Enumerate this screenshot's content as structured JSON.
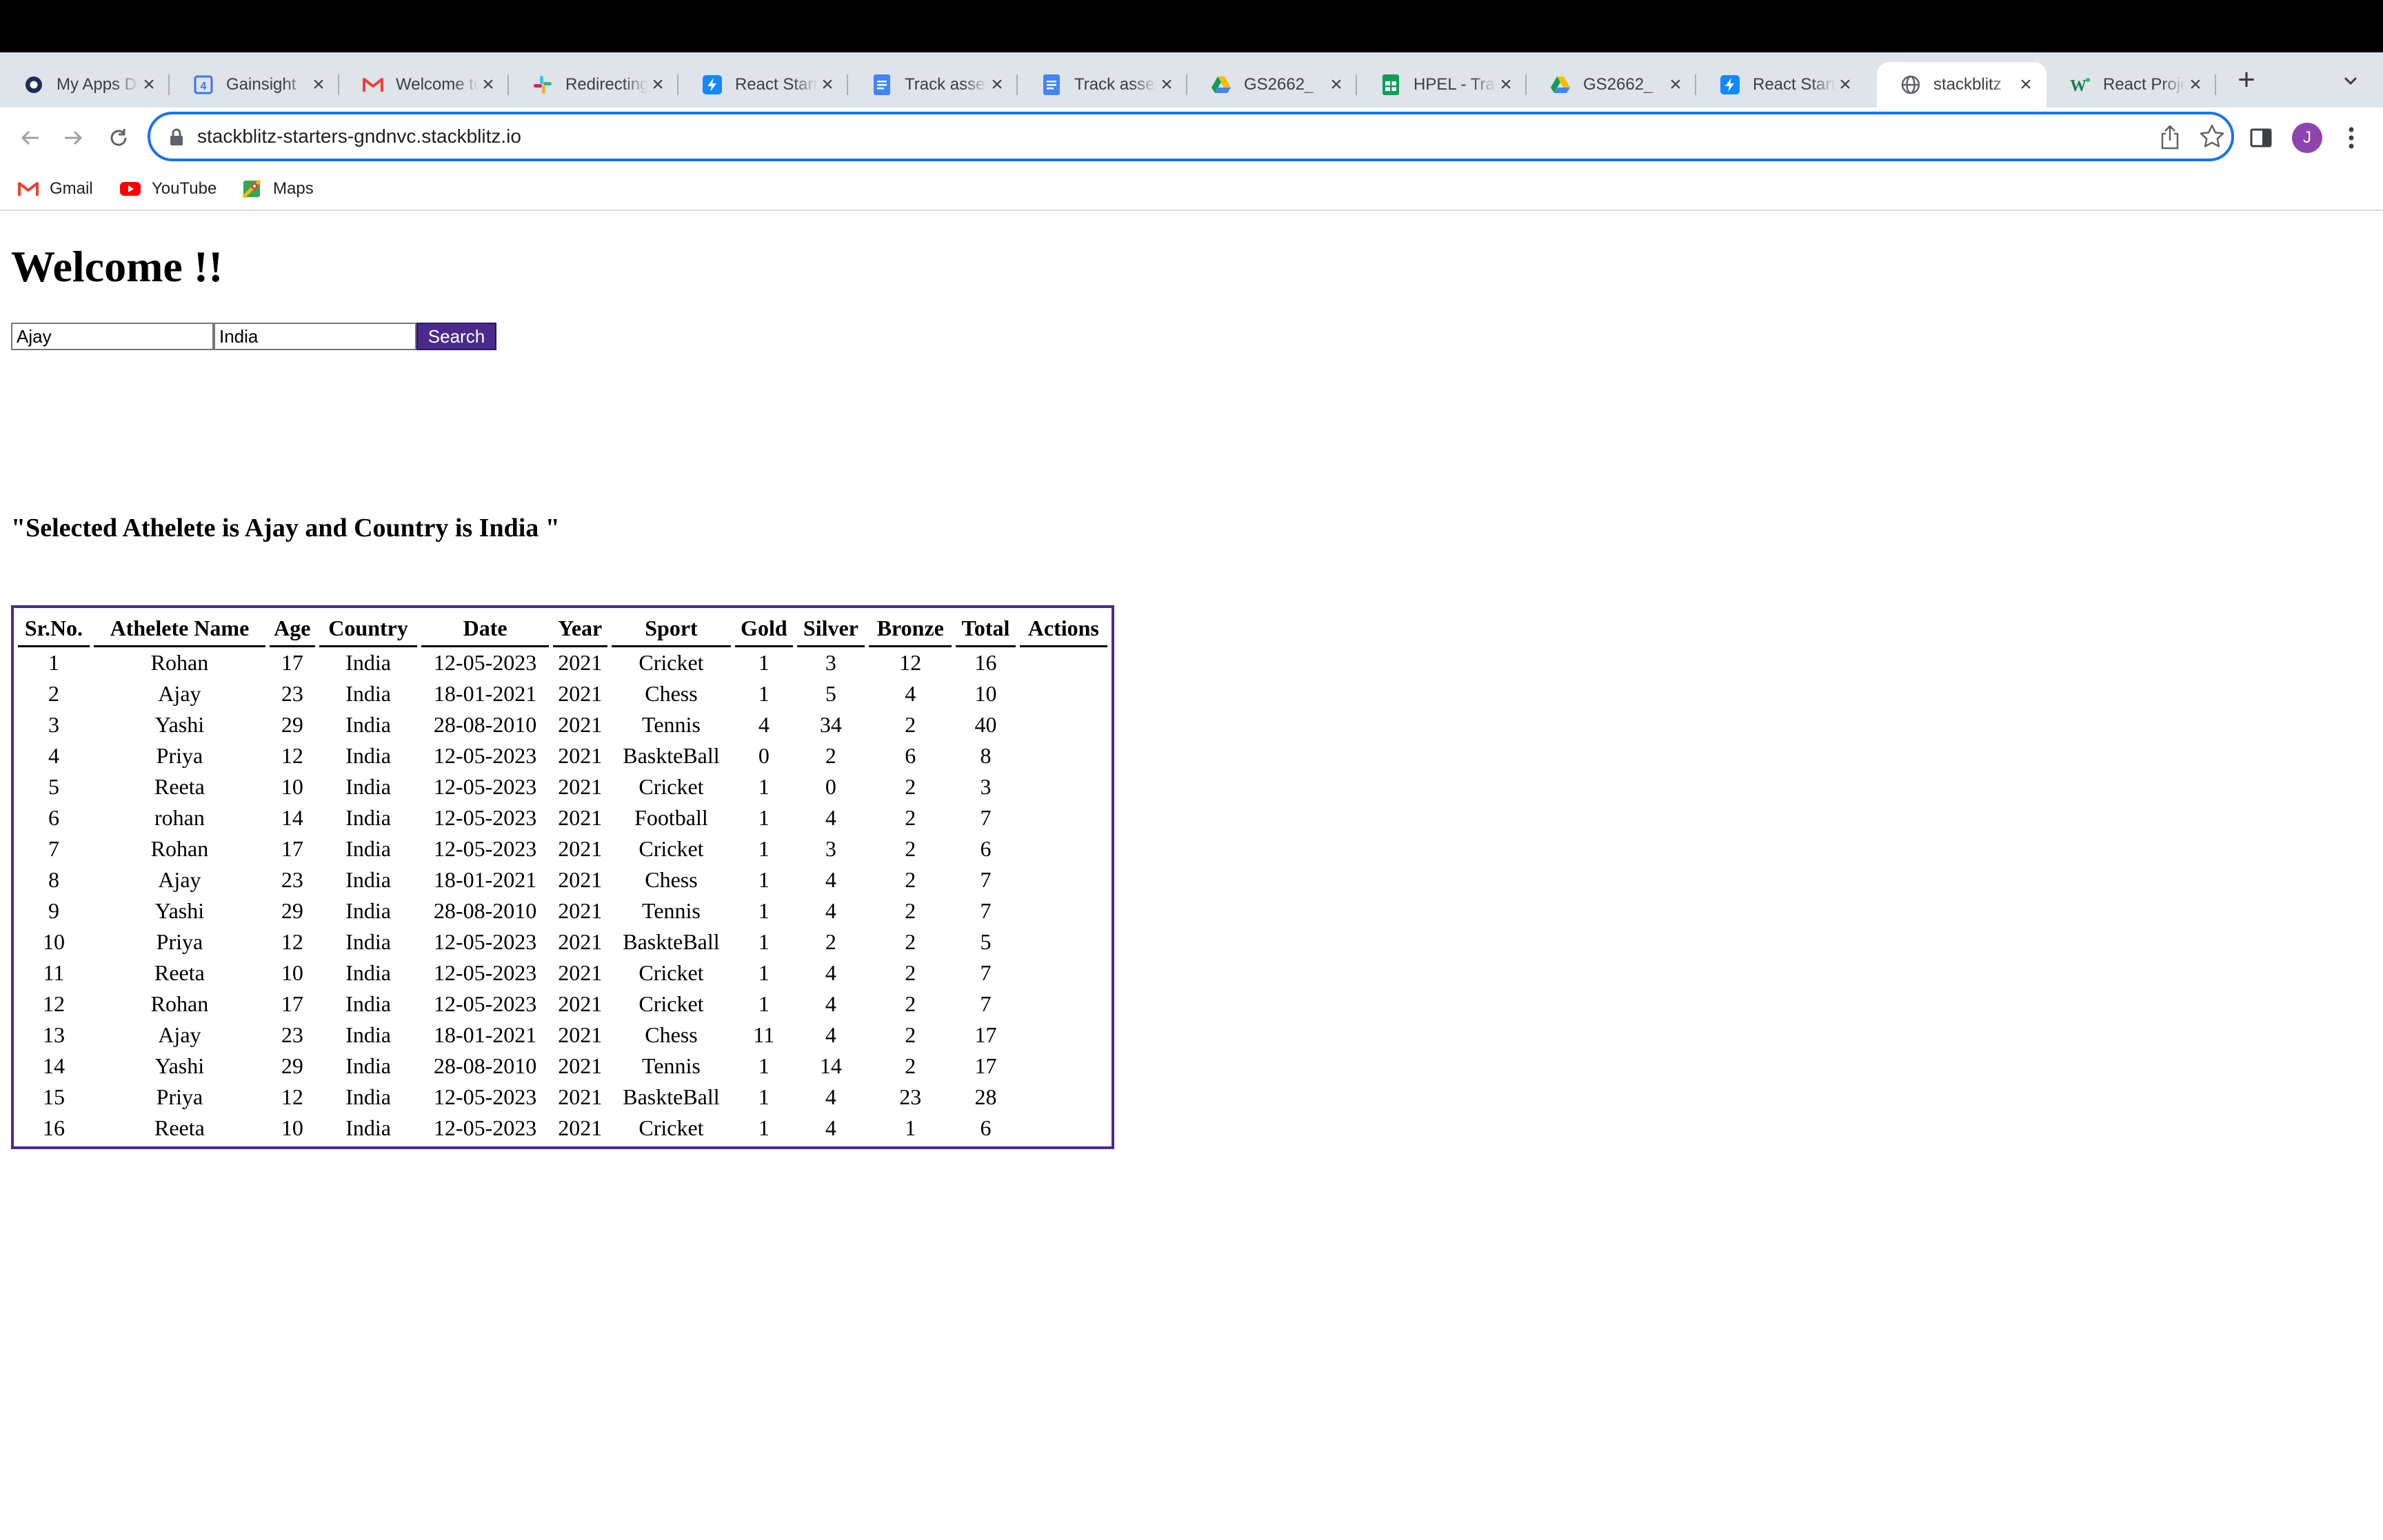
{
  "browser": {
    "tabs": [
      {
        "title": "My Apps Dashboard",
        "icon": "okta-icon"
      },
      {
        "title": "Gainsight",
        "icon": "gainsight-icon"
      },
      {
        "title": "Welcome to Gmail",
        "icon": "gmail-icon"
      },
      {
        "title": "Redirecting",
        "icon": "slack-icon"
      },
      {
        "title": "React Starter",
        "icon": "stackblitz-icon"
      },
      {
        "title": "Track assets",
        "icon": "docs-icon"
      },
      {
        "title": "Track assets",
        "icon": "docs-icon"
      },
      {
        "title": "GS2662_",
        "icon": "drive-icon"
      },
      {
        "title": "HPEL - Tracker",
        "icon": "sheets-icon"
      },
      {
        "title": "GS2662_",
        "icon": "drive-icon"
      },
      {
        "title": "React Starter",
        "icon": "stackblitz-icon"
      },
      {
        "title": "stackblitz",
        "icon": "globe-icon",
        "active": true
      },
      {
        "title": "React Project",
        "icon": "w-icon"
      }
    ],
    "url": "stackblitz-starters-gndnvc.stackblitz.io",
    "profile_initial": "J",
    "bookmarks": [
      {
        "label": "Gmail",
        "icon": "gmail-icon"
      },
      {
        "label": "YouTube",
        "icon": "youtube-icon"
      },
      {
        "label": "Maps",
        "icon": "maps-icon"
      }
    ]
  },
  "page": {
    "heading": "Welcome !!",
    "athlete_input_value": "Ajay",
    "country_input_value": "India",
    "search_label": "Search",
    "selected_text": "\"Selected Athelete is Ajay and Country is India \"",
    "table": {
      "headers": [
        "Sr.No.",
        "Athelete Name",
        "Age",
        "Country",
        "Date",
        "Year",
        "Sport",
        "Gold",
        "Silver",
        "Bronze",
        "Total",
        "Actions"
      ],
      "rows": [
        [
          "1",
          "Rohan",
          "17",
          "India",
          "12-05-2023",
          "2021",
          "Cricket",
          "1",
          "3",
          "12",
          "16",
          ""
        ],
        [
          "2",
          "Ajay",
          "23",
          "India",
          "18-01-2021",
          "2021",
          "Chess",
          "1",
          "5",
          "4",
          "10",
          ""
        ],
        [
          "3",
          "Yashi",
          "29",
          "India",
          "28-08-2010",
          "2021",
          "Tennis",
          "4",
          "34",
          "2",
          "40",
          ""
        ],
        [
          "4",
          "Priya",
          "12",
          "India",
          "12-05-2023",
          "2021",
          "BaskteBall",
          "0",
          "2",
          "6",
          "8",
          ""
        ],
        [
          "5",
          "Reeta",
          "10",
          "India",
          "12-05-2023",
          "2021",
          "Cricket",
          "1",
          "0",
          "2",
          "3",
          ""
        ],
        [
          "6",
          "rohan",
          "14",
          "India",
          "12-05-2023",
          "2021",
          "Football",
          "1",
          "4",
          "2",
          "7",
          ""
        ],
        [
          "7",
          "Rohan",
          "17",
          "India",
          "12-05-2023",
          "2021",
          "Cricket",
          "1",
          "3",
          "2",
          "6",
          ""
        ],
        [
          "8",
          "Ajay",
          "23",
          "India",
          "18-01-2021",
          "2021",
          "Chess",
          "1",
          "4",
          "2",
          "7",
          ""
        ],
        [
          "9",
          "Yashi",
          "29",
          "India",
          "28-08-2010",
          "2021",
          "Tennis",
          "1",
          "4",
          "2",
          "7",
          ""
        ],
        [
          "10",
          "Priya",
          "12",
          "India",
          "12-05-2023",
          "2021",
          "BaskteBall",
          "1",
          "2",
          "2",
          "5",
          ""
        ],
        [
          "11",
          "Reeta",
          "10",
          "India",
          "12-05-2023",
          "2021",
          "Cricket",
          "1",
          "4",
          "2",
          "7",
          ""
        ],
        [
          "12",
          "Rohan",
          "17",
          "India",
          "12-05-2023",
          "2021",
          "Cricket",
          "1",
          "4",
          "2",
          "7",
          ""
        ],
        [
          "13",
          "Ajay",
          "23",
          "India",
          "18-01-2021",
          "2021",
          "Chess",
          "11",
          "4",
          "2",
          "17",
          ""
        ],
        [
          "14",
          "Yashi",
          "29",
          "India",
          "28-08-2010",
          "2021",
          "Tennis",
          "1",
          "14",
          "2",
          "17",
          ""
        ],
        [
          "15",
          "Priya",
          "12",
          "India",
          "12-05-2023",
          "2021",
          "BaskteBall",
          "1",
          "4",
          "23",
          "28",
          ""
        ],
        [
          "16",
          "Reeta",
          "10",
          "India",
          "12-05-2023",
          "2021",
          "Cricket",
          "1",
          "4",
          "1",
          "6",
          ""
        ]
      ]
    }
  },
  "colors": {
    "accent": "#4b2a8c",
    "focus_ring": "#1a73e8",
    "tabstrip": "#dfe3ea"
  }
}
